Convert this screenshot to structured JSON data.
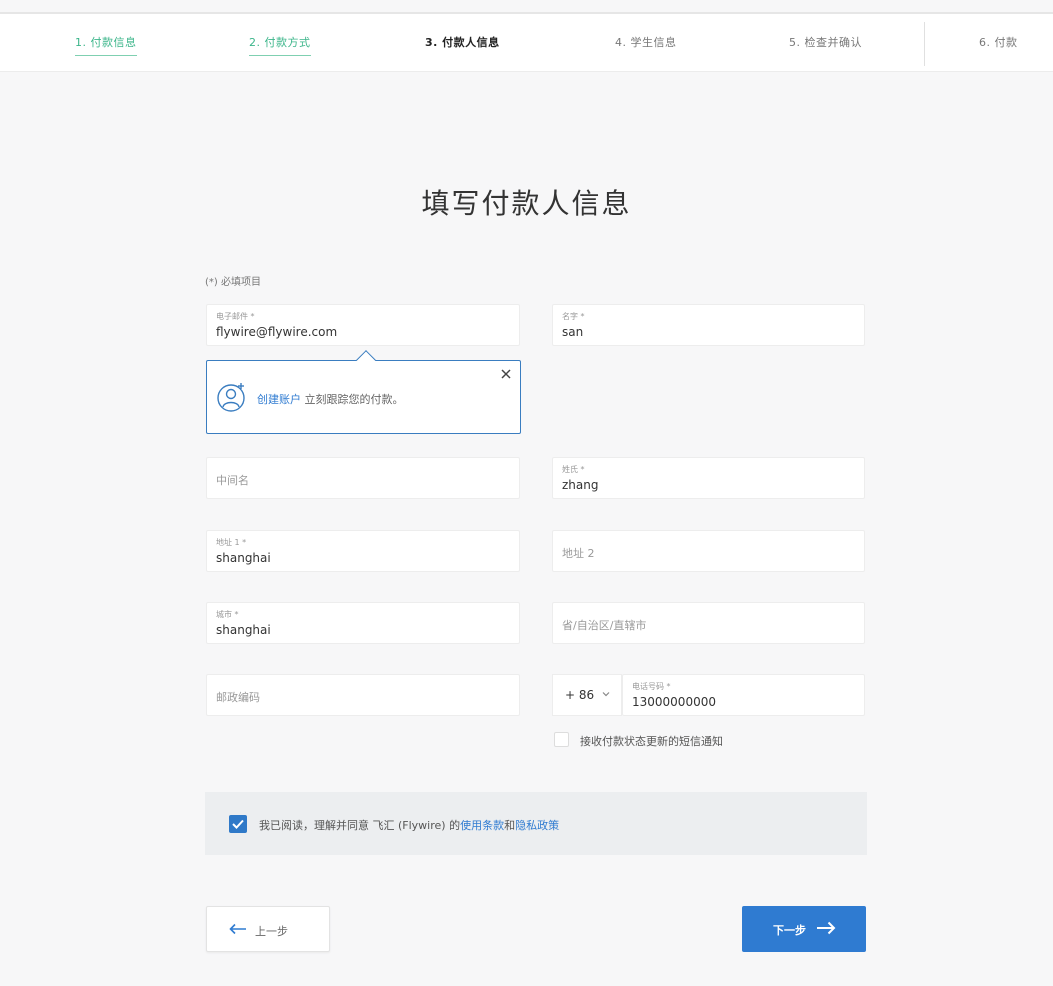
{
  "stepper": {
    "steps": [
      {
        "label": "1. 付款信息",
        "state": "done"
      },
      {
        "label": "2. 付款方式",
        "state": "done"
      },
      {
        "label": "3. 付款人信息",
        "state": "active"
      },
      {
        "label": "4. 学生信息",
        "state": "todo"
      },
      {
        "label": "5. 检查并确认",
        "state": "todo"
      },
      {
        "label": "6. 付款",
        "state": "todo"
      }
    ]
  },
  "page": {
    "title": "填写付款人信息",
    "required_note": "(*) 必填项目"
  },
  "form": {
    "email": {
      "label": "电子邮件 *",
      "value": "flywire@flywire.com"
    },
    "first_name": {
      "label": "名字 *",
      "value": "san"
    },
    "middle_name": {
      "placeholder": "中间名"
    },
    "last_name": {
      "label": "姓氏 *",
      "value": "zhang"
    },
    "address1": {
      "label": "地址 1 *",
      "value": "shanghai"
    },
    "address2": {
      "placeholder": "地址 2"
    },
    "city": {
      "label": "城市 *",
      "value": "shanghai"
    },
    "province": {
      "placeholder": "省/自治区/直辖市"
    },
    "postal": {
      "placeholder": "邮政编码"
    },
    "phone_code": {
      "value": "+ 86"
    },
    "phone": {
      "label": "电话号码 *",
      "value": "13000000000"
    },
    "sms_label": "接收付款状态更新的短信通知"
  },
  "popover": {
    "link": "创建账户",
    "text": " 立刻跟踪您的付款。"
  },
  "terms": {
    "prefix": "我已阅读，理解并同意 飞汇 (Flywire) 的",
    "terms_link": "使用条款",
    "and": "和",
    "privacy_link": "隐私政策",
    "checked": true
  },
  "buttons": {
    "back": "上一步",
    "next": "下一步"
  },
  "colors": {
    "accent": "#2f7bd1",
    "done_step": "#3bb58a",
    "popover_border": "#3a7dc0"
  }
}
